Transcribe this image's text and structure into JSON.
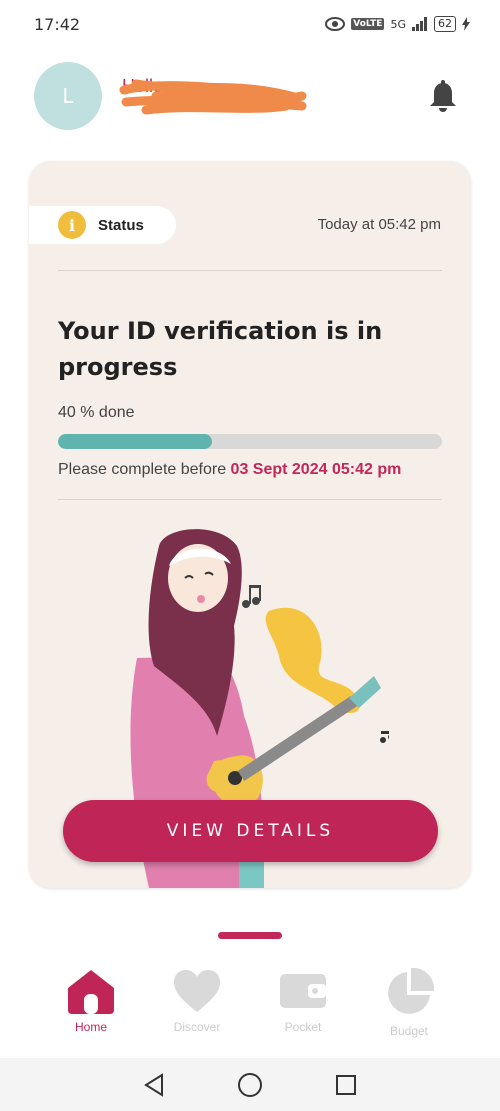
{
  "status_bar": {
    "time": "17:42",
    "network_label": "5G",
    "volte_label": "VoLTE",
    "battery": "62"
  },
  "header": {
    "avatar_initial": "L",
    "greeting": "Hello"
  },
  "card": {
    "status_label": "Status",
    "timestamp": "Today at 05:42 pm",
    "title": "Your ID verification is in progress",
    "progress_text": "40 % done",
    "progress_percent": 40,
    "deadline_prefix": "Please complete before ",
    "deadline_date": "03 Sept 2024 05:42 pm",
    "button_label": "VIEW DETAILS"
  },
  "nav": {
    "items": [
      {
        "label": "Home",
        "icon": "home-icon",
        "active": true
      },
      {
        "label": "Discover",
        "icon": "heart-icon",
        "active": false
      },
      {
        "label": "Pocket",
        "icon": "wallet-icon",
        "active": false
      },
      {
        "label": "Budget",
        "icon": "pie-chart-icon",
        "active": false
      }
    ]
  },
  "colors": {
    "accent": "#bf2657",
    "progress": "#5fb5ae",
    "card_bg": "#f6eee9",
    "avatar_bg": "#bfe0df"
  }
}
